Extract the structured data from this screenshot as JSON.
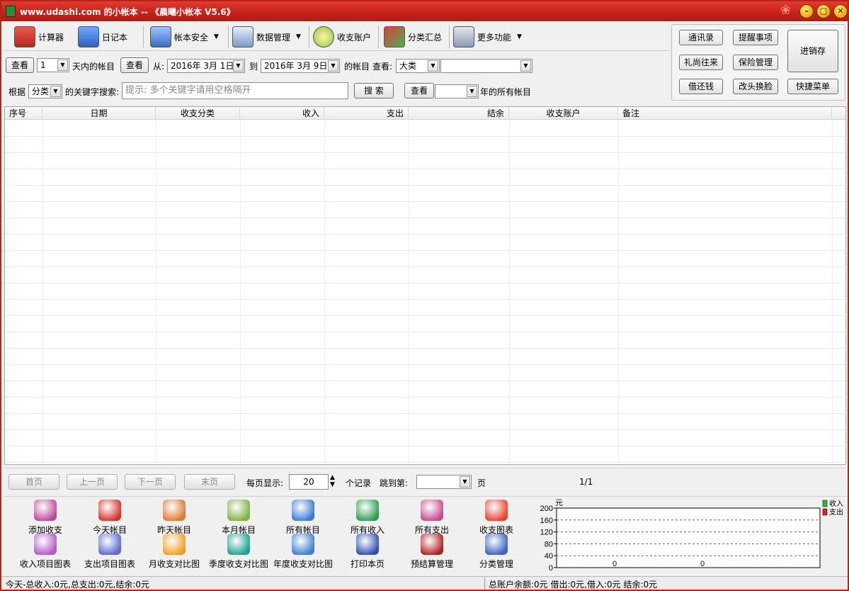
{
  "window": {
    "title": "www.udashi.com 的小帐本 -- 《晨曦小帐本 V5.6》"
  },
  "toolbar": {
    "calculator": "计算器",
    "diary": "日记本",
    "book_security": "帐本安全",
    "data_management": "数据管理",
    "accounts": "收支账户",
    "category_summary": "分类汇总",
    "more_functions": "更多功能"
  },
  "right_panel": {
    "contacts": "通讯录",
    "reminders": "提醒事项",
    "inventory": "进销存",
    "gifts": "礼尚往来",
    "insurance": "保险管理",
    "loans": "借还钱",
    "makeover": "改头换脸",
    "shortcut_menu": "快捷菜单"
  },
  "filter": {
    "view_btn": "查看",
    "days_value": "1",
    "days_suffix": "天内的帐目",
    "view_btn2": "查看",
    "from_label": "从:",
    "from_date": "2016年  3月  1日",
    "to_label": "到",
    "to_date": "2016年  3月  9日",
    "accounts_of": "的帐目",
    "view_label": "查看:",
    "category_level": "大类",
    "category_value": "",
    "by_label": "根据",
    "by_value": "分类",
    "keyword_label": "的关键字搜索:",
    "keyword_placeholder": "提示:  多个关键字请用空格隔开",
    "search_btn": "搜 索",
    "view_btn3": "查看",
    "year_value": "",
    "year_suffix": "年的所有帐目"
  },
  "table": {
    "headers": [
      "序号",
      "日期",
      "收支分类",
      "收入",
      "支出",
      "结余",
      "收支账户",
      "备注"
    ],
    "rows": []
  },
  "pager": {
    "first": "首页",
    "prev": "上一页",
    "next": "下一页",
    "last": "末页",
    "per_page_label": "每页显示:",
    "per_page_value": "20",
    "records_label": "个记录",
    "jump_label": "跳到第:",
    "jump_value": "",
    "page_suffix": "页",
    "page_indicator": "1/1"
  },
  "bottom_buttons": [
    {
      "label": "添加收支",
      "icon": "add-income-expense-icon",
      "color": "#c0479a"
    },
    {
      "label": "今天帐目",
      "icon": "today-icon",
      "color": "#d6302a"
    },
    {
      "label": "昨天帐目",
      "icon": "yesterday-folder-icon",
      "color": "#e07a30"
    },
    {
      "label": "本月帐目",
      "icon": "month-folder-icon",
      "color": "#7cb342"
    },
    {
      "label": "所有帐目",
      "icon": "all-accounts-icon",
      "color": "#3a7bd5"
    },
    {
      "label": "所有收入",
      "icon": "all-income-icon",
      "color": "#2e9e4f"
    },
    {
      "label": "所有支出",
      "icon": "all-expense-icon",
      "color": "#c64b8c"
    },
    {
      "label": "收支图表",
      "icon": "pie-chart-icon",
      "color": "#e8402f"
    },
    {
      "label": "收入项目图表",
      "icon": "income-chart-icon",
      "color": "#b05ac8"
    },
    {
      "label": "支出项目图表",
      "icon": "expense-chart-icon",
      "color": "#5a6ad0"
    },
    {
      "label": "月收支对比图",
      "icon": "monthly-compare-icon",
      "color": "#f0a020"
    },
    {
      "label": "季度收支对比图",
      "icon": "quarterly-compare-icon",
      "color": "#20a090"
    },
    {
      "label": "年度收支对比图",
      "icon": "yearly-compare-icon",
      "color": "#3f7fd0"
    },
    {
      "label": "打印本页",
      "icon": "print-icon",
      "color": "#3050b0"
    },
    {
      "label": "预结算管理",
      "icon": "settlement-icon",
      "color": "#b02020"
    },
    {
      "label": "分类管理",
      "icon": "category-icon",
      "color": "#3a60c0"
    }
  ],
  "chart_data": {
    "type": "bar",
    "ylabel": "元",
    "ylim": [
      0,
      200
    ],
    "yticks": [
      0,
      40,
      80,
      120,
      160,
      200
    ],
    "categories": [
      ""
    ],
    "series": [
      {
        "name": "收入",
        "values": [
          0
        ],
        "color": "#2db82d"
      },
      {
        "name": "支出",
        "values": [
          0
        ],
        "color": "#e02020"
      }
    ],
    "data_labels": [
      "0",
      "0"
    ],
    "grid": true,
    "legend": "top-right"
  },
  "statusbar": {
    "left": "今天-总收入:0元,总支出:0元,结余:0元",
    "right": "总账户余额:0元 借出:0元,借入:0元 结余:0元"
  }
}
